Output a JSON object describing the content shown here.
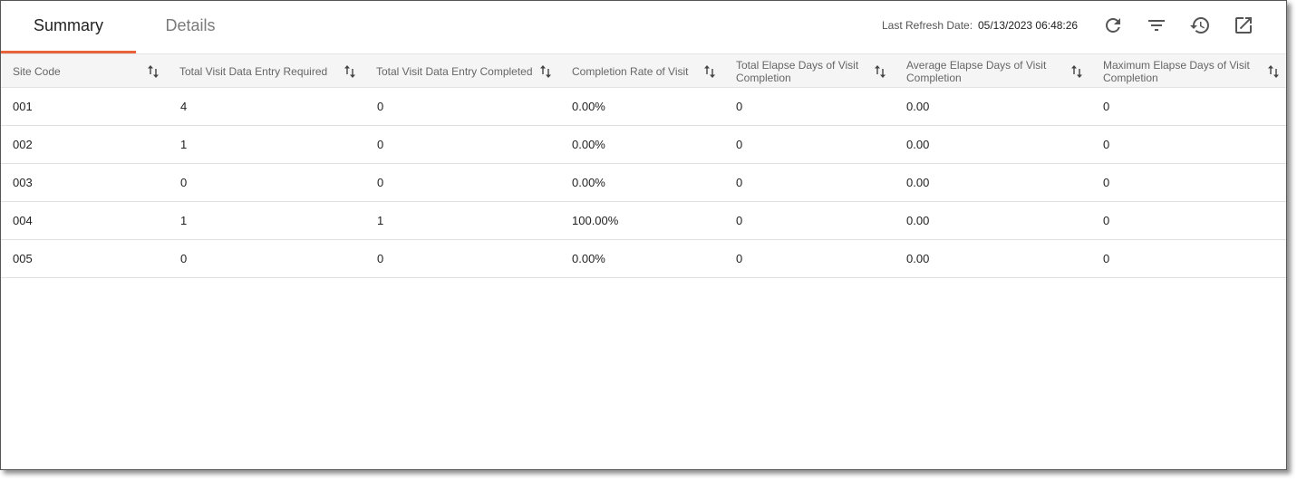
{
  "tabs": [
    {
      "label": "Summary",
      "active": true
    },
    {
      "label": "Details",
      "active": false
    }
  ],
  "toolbar": {
    "refresh_label": "Last Refresh Date:",
    "refresh_value": "05/13/2023 06:48:26",
    "icons": [
      "refresh-icon",
      "filter-icon",
      "history-icon",
      "open-external-icon"
    ]
  },
  "colors": {
    "accent": "#e8623a",
    "header_bg": "#f5f5f5",
    "icon": "#555555"
  },
  "table": {
    "columns": [
      "Site Code",
      "Total Visit Data Entry Required",
      "Total Visit Data Entry Completed",
      "Completion Rate of Visit",
      "Total Elapse Days of Visit Completion",
      "Average Elapse Days of Visit Completion",
      "Maximum Elapse Days of Visit Completion"
    ],
    "rows": [
      [
        "001",
        "4",
        "0",
        "0.00%",
        "0",
        "0.00",
        "0"
      ],
      [
        "002",
        "1",
        "0",
        "0.00%",
        "0",
        "0.00",
        "0"
      ],
      [
        "003",
        "0",
        "0",
        "0.00%",
        "0",
        "0.00",
        "0"
      ],
      [
        "004",
        "1",
        "1",
        "100.00%",
        "0",
        "0.00",
        "0"
      ],
      [
        "005",
        "0",
        "0",
        "0.00%",
        "0",
        "0.00",
        "0"
      ]
    ]
  }
}
